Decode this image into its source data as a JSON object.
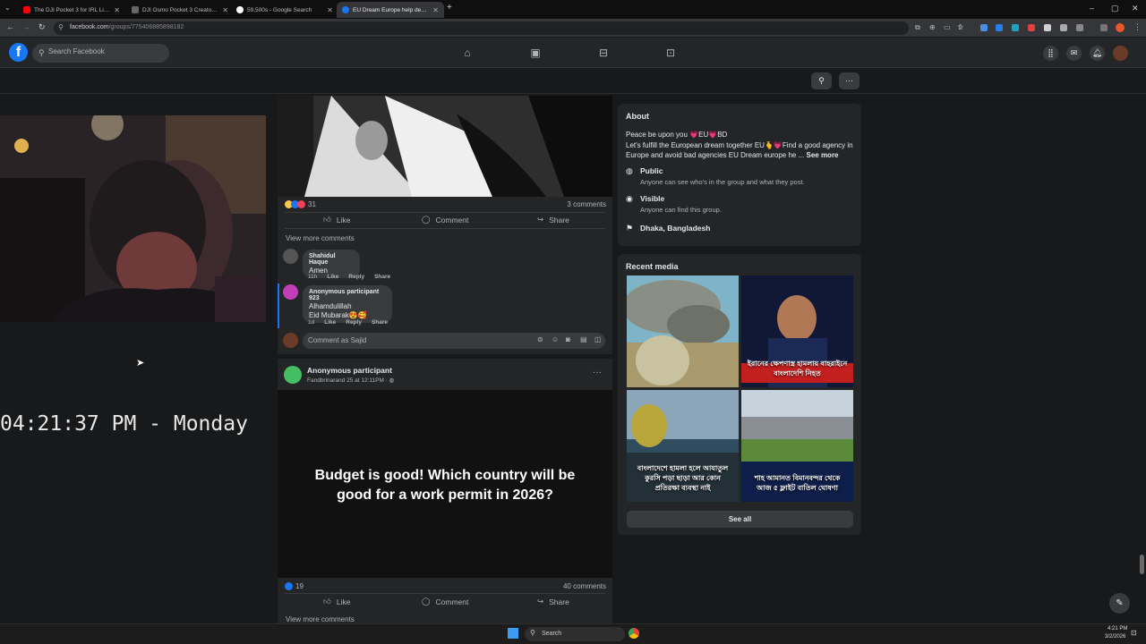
{
  "browser": {
    "tabs": [
      {
        "label": "The DJI Pocket 3 for IRL Live-st",
        "icon": "youtube-icon",
        "color": "#ff0000"
      },
      {
        "label": "DJI Osmo Pocket 3 Creator Co",
        "icon": "dji-icon",
        "color": "#555555"
      },
      {
        "label": "59,500s - Google Search",
        "icon": "google-icon",
        "color": "#4285f4"
      },
      {
        "label": "EU Dream Europe help desk so",
        "icon": "facebook-icon",
        "color": "#1877f2"
      }
    ],
    "url_host": "facebook.com",
    "url_path": "/groups/775406885898182"
  },
  "fb": {
    "search_placeholder": "Search Facebook"
  },
  "overlay": {
    "clock": "04:21:37 PM - Monday"
  },
  "post1": {
    "reaction_count": "31",
    "comments_count": "3 comments",
    "like_label": "Like",
    "comment_label": "Comment",
    "share_label": "Share",
    "view_more": "View more comments",
    "comments": [
      {
        "name": "Shahidul Haque",
        "text": "Amen",
        "time": "11h",
        "like": "Like",
        "reply": "Reply",
        "share": "Share"
      },
      {
        "name": "Anonymous participant 923",
        "text": "Alhamdulillah",
        "text2": "Eid Mubarak😍🥰",
        "time": "1d",
        "like": "Like",
        "reply": "Reply",
        "share": "Share"
      }
    ],
    "comment_placeholder": "Comment as Sajid"
  },
  "post2": {
    "author": "Anonymous participant",
    "meta": "Fandbrinarand 25 at 12:11PM · ",
    "body": "Budget is good! Which country will be good for a work permit in 2026?",
    "reaction_count": "19",
    "comments_count": "40 comments",
    "like_label": "Like",
    "comment_label": "Comment",
    "share_label": "Share",
    "view_more": "View more comments"
  },
  "about": {
    "title": "About",
    "line1": "Peace be upon you 💗EU💗BD",
    "line2": "Let's fulfill the European dream together EU🫰💗Find a good agency in Europe and avoid bad agencies EU Dream europe he ...",
    "see_more": "See more",
    "public_title": "Public",
    "public_desc": "Anyone can see who's in the group and what they post.",
    "visible_title": "Visible",
    "visible_desc": "Anyone can find this group.",
    "location": "Dhaka, Bangladesh"
  },
  "media": {
    "title": "Recent media",
    "see_all": "See all",
    "captions": [
      "",
      "ইরানের ক্ষেপণাস্ত্র হামলায় বাহরাইনে বাংলাদেশি নিহত",
      "বাংলাদেশে হামলা হলে আযাতুল কুরসি পড়া ছাড়া আর কোন প্রতিরক্ষা ব্যবস্থা নাই",
      "শাহ আমানত বিমানবন্দর থেকে আজ ৫ ফ্লাইট বাতিল ঘোষণা"
    ]
  },
  "taskbar": {
    "search_label": "Search",
    "time": "4:21 PM",
    "date": "3/2/2026"
  }
}
